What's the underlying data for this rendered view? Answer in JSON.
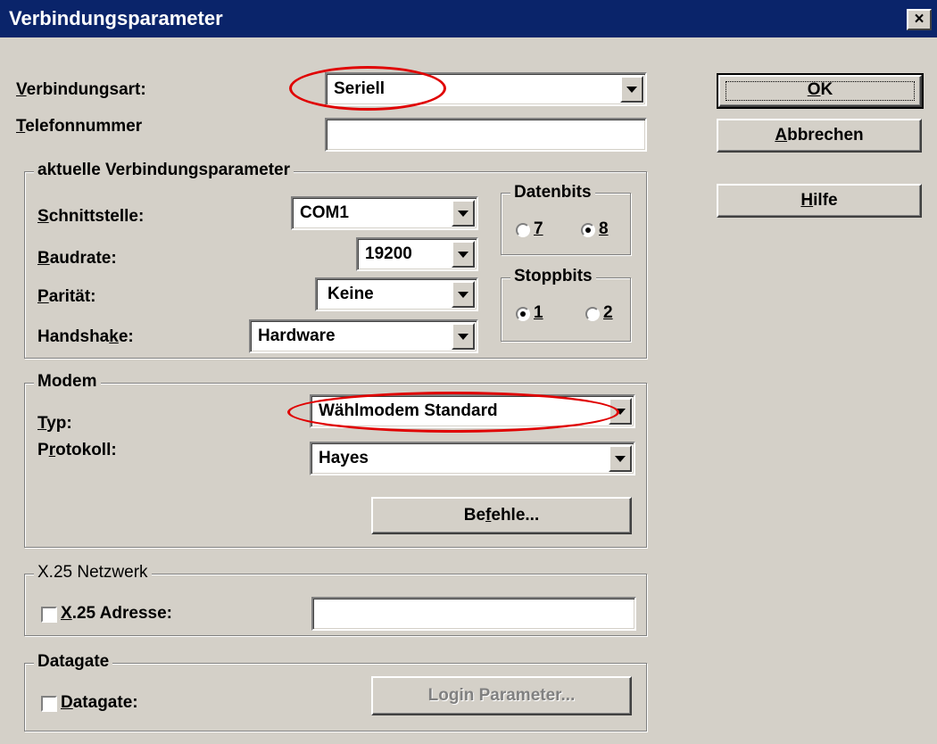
{
  "window": {
    "title": "Verbindungsparameter",
    "close_glyph": "×"
  },
  "connection": {
    "type_label_key": "V",
    "type_label_rest": "erbindungsart:",
    "type_value": "Seriell",
    "phone_label_key": "T",
    "phone_label_rest": "elefonnummer",
    "phone_value": ""
  },
  "current_params": {
    "legend": "aktuelle Verbindungsparameter",
    "interface_label_key": "S",
    "interface_label_rest": "chnittstelle:",
    "interface_value": "COM1",
    "baud_label_key": "B",
    "baud_label_rest": "audrate:",
    "baud_value": "19200",
    "parity_label_key": "P",
    "parity_label_rest": "arität:",
    "parity_value": "Keine",
    "handshake_label_pre": "Handsha",
    "handshake_label_key": "k",
    "handshake_label_rest": "e:",
    "handshake_value": "Hardware",
    "databits": {
      "legend": "Datenbits",
      "opt1": "7",
      "opt2": "8",
      "selected": "8"
    },
    "stopbits": {
      "legend": "Stoppbits",
      "opt1": "1",
      "opt2": "2",
      "selected": "1"
    }
  },
  "modem": {
    "legend": "Modem",
    "type_label_key": "T",
    "type_label_rest": "yp:",
    "type_value": "Wählmodem Standard",
    "protocol_label_pre": "P",
    "protocol_label_key": "r",
    "protocol_label_rest": "otokoll:",
    "protocol_value": "Hayes",
    "commands_pre": "Be",
    "commands_key": "f",
    "commands_rest": "ehle..."
  },
  "x25": {
    "legend": "X.25 Netzwerk",
    "checkbox_key": "X",
    "checkbox_rest": ".25 Adresse:",
    "checked": false,
    "address_value": ""
  },
  "datagate": {
    "legend": "Datagate",
    "checkbox_key": "D",
    "checkbox_rest": "atagate:",
    "checked": false,
    "login_button": "Login Parameter..."
  },
  "buttons": {
    "ok_key": "O",
    "ok_rest": "K",
    "cancel_key": "A",
    "cancel_rest": "bbrechen",
    "help_key": "H",
    "help_rest": "ilfe"
  },
  "colors": {
    "titlebar": "#0a246a",
    "face": "#d4d0c8",
    "highlight_ellipse": "#e00000"
  }
}
